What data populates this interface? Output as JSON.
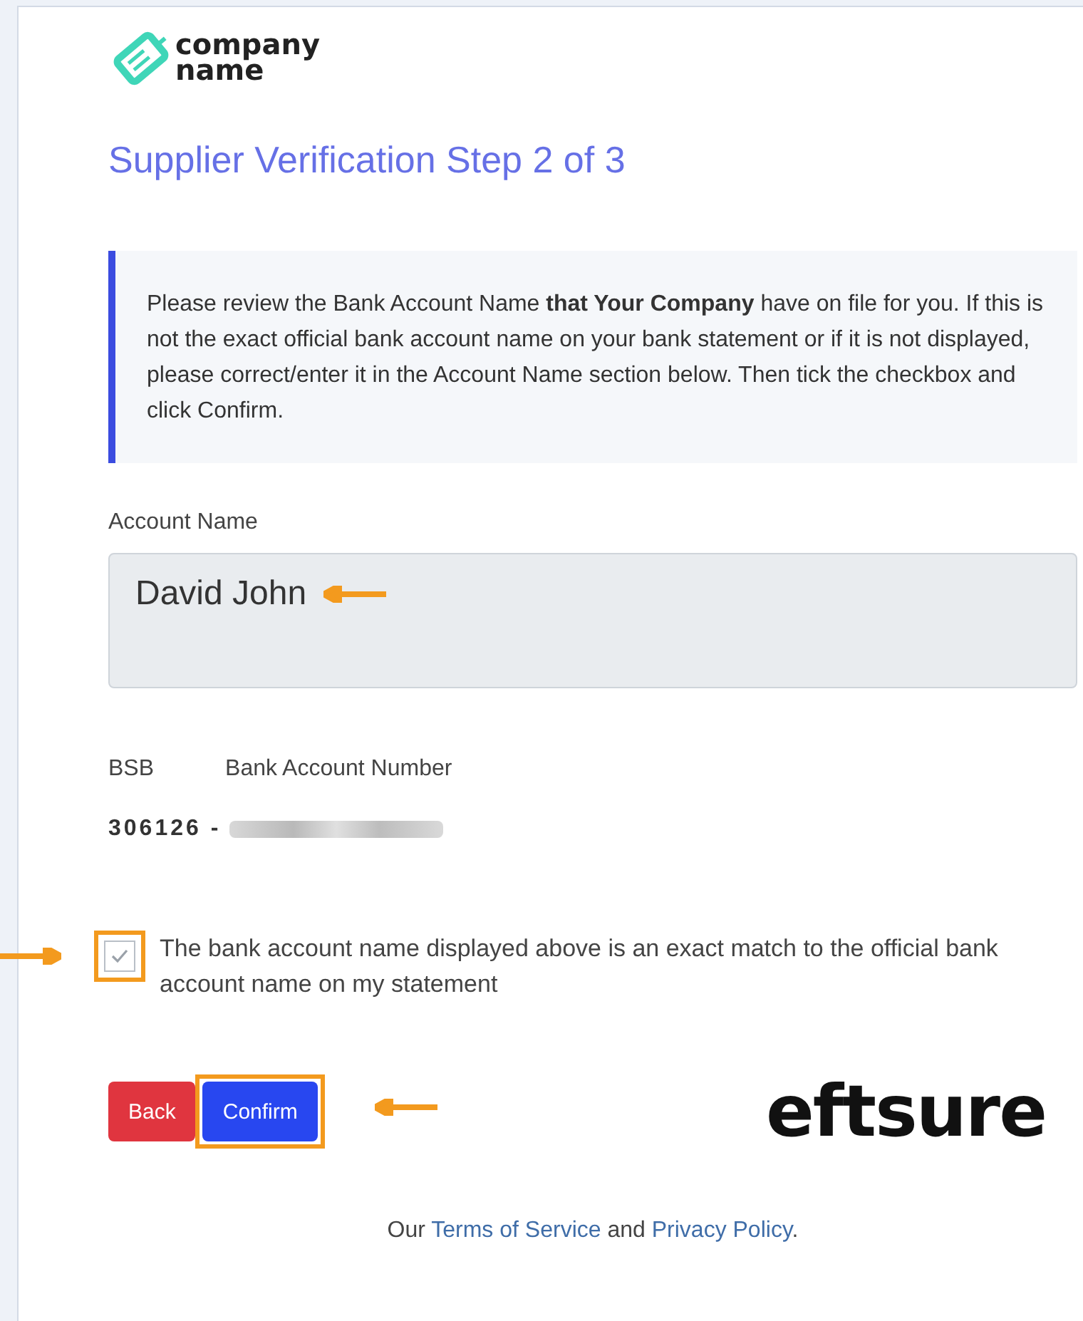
{
  "logo": {
    "text_line_1": "company",
    "text_line_2": "name"
  },
  "title": "Supplier Verification Step 2 of 3",
  "notice": "Please review the Bank Account Name **that Your Company** have on file for you. If this is not the exact official bank account name on your bank statement or if it is not displayed, please correct/enter it in the Account Name section below. Then tick the checkbox and click Confirm.",
  "account_name": {
    "label": "Account Name",
    "value": "David John",
    "arrow_marker": true
  },
  "bank_details": {
    "bsb_label": "BSB",
    "number_label": "Bank Account Number",
    "bsb": "306126 -",
    "number_redacted": true
  },
  "confirmation": {
    "label": "The bank account name displayed above is an exact match to the official bank account name on my statement",
    "checked": true,
    "highlighted": true
  },
  "buttons": [
    {
      "label": "Back",
      "kind": "danger",
      "highlighted": false
    },
    {
      "label": "Confirm",
      "kind": "primary",
      "highlighted": true
    }
  ],
  "brand": "eftsure",
  "footer": {
    "prefix": "Our ",
    "terms_link": "Terms of Service",
    "middle": " and ",
    "privacy_link": "Privacy Policy",
    "suffix": "."
  }
}
